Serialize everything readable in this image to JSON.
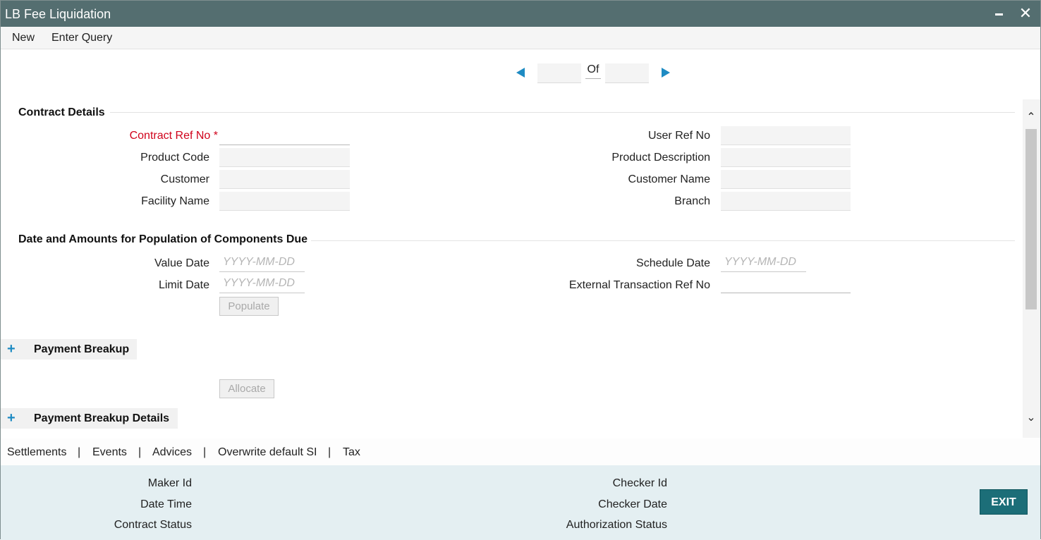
{
  "window": {
    "title": "LB Fee Liquidation"
  },
  "menu": {
    "new_label": "New",
    "enter_query_label": "Enter Query"
  },
  "pager": {
    "of_label": "Of",
    "current": "",
    "total": ""
  },
  "contract_details": {
    "title": "Contract Details",
    "contract_ref_no_label": "Contract Ref No",
    "required_marker": "*",
    "product_code_label": "Product Code",
    "customer_label": "Customer",
    "facility_name_label": "Facility Name",
    "user_ref_no_label": "User Ref No",
    "product_description_label": "Product Description",
    "customer_name_label": "Customer Name",
    "branch_label": "Branch"
  },
  "dates_amounts": {
    "title": "Date and Amounts for Population of Components Due",
    "value_date_label": "Value Date",
    "limit_date_label": "Limit Date",
    "schedule_date_label": "Schedule Date",
    "external_txn_ref_label": "External Transaction Ref No",
    "date_placeholder": "YYYY-MM-DD",
    "populate_label": "Populate"
  },
  "payment_breakup": {
    "title": "Payment Breakup",
    "allocate_label": "Allocate"
  },
  "payment_breakup_details": {
    "title": "Payment Breakup Details"
  },
  "footer_links": [
    "Settlements",
    "Events",
    "Advices",
    "Overwrite default SI",
    "Tax"
  ],
  "footer_separator": "|",
  "audit": {
    "maker_id_label": "Maker Id",
    "date_time_label": "Date Time",
    "contract_status_label": "Contract Status",
    "checker_id_label": "Checker Id",
    "checker_date_label": "Checker Date",
    "authorization_status_label": "Authorization Status",
    "exit_label": "EXIT"
  },
  "colors": {
    "titlebar": "#546e70",
    "accent": "#1e8bc3",
    "required": "#d0021b",
    "exit": "#1c6e78",
    "audit_bg": "#e4eff2"
  }
}
